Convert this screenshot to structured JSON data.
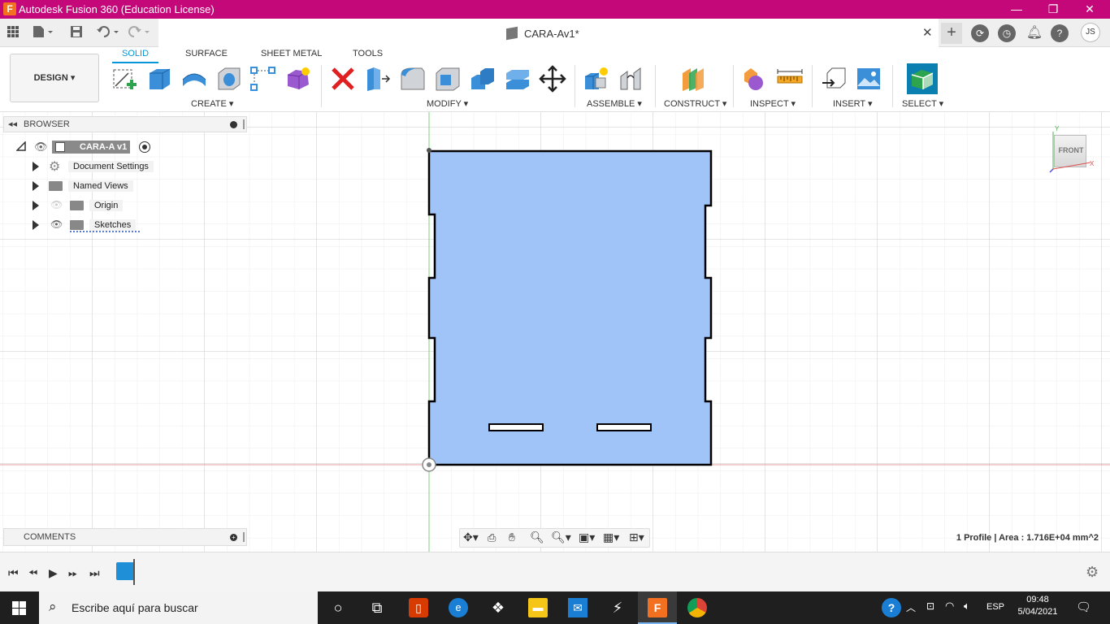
{
  "window": {
    "title": "Autodesk Fusion 360 (Education License)",
    "logo_letter": "F",
    "minimize": "—",
    "restore": "❐",
    "close": "✕"
  },
  "document": {
    "tab_title": "CARA-Av1*",
    "close": "✕",
    "new_tab": "+"
  },
  "user": {
    "initials": "JS"
  },
  "toolbar": {
    "workspace": "DESIGN ▾",
    "tabs": [
      "SOLID",
      "SURFACE",
      "SHEET METAL",
      "TOOLS"
    ],
    "groups": {
      "create": "CREATE ▾",
      "modify": "MODIFY ▾",
      "assemble": "ASSEMBLE ▾",
      "construct": "CONSTRUCT ▾",
      "inspect": "INSPECT ▾",
      "insert": "INSERT ▾",
      "select": "SELECT ▾"
    }
  },
  "browser": {
    "header": "BROWSER",
    "root": "CARA-A v1",
    "items": [
      "Document Settings",
      "Named Views",
      "Origin",
      "Sketches"
    ]
  },
  "comments": {
    "header": "COMMENTS"
  },
  "viewcube": {
    "face": "FRONT",
    "axis_y": "Y",
    "axis_x": "X"
  },
  "status": {
    "profile": "1 Profile | Area : 1.716E+04 mm^2"
  },
  "taskbar": {
    "search_placeholder": "Escribe aquí para buscar",
    "language": "ESP",
    "time": "09:48",
    "date": "5/04/2021"
  },
  "colors": {
    "title_bar": "#c4087a",
    "accent": "#0696d7",
    "profile_fill": "#a0c4f7",
    "taskbar": "#1f1f1f"
  }
}
